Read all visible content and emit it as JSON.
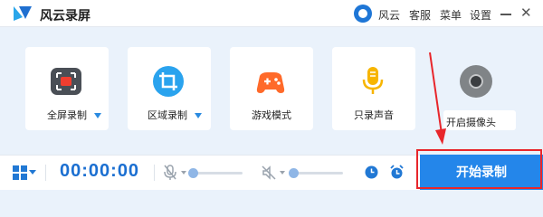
{
  "window": {
    "title": "风云录屏"
  },
  "titlebar": {
    "brand_label": "风云",
    "service_label": "客服",
    "menu_label": "菜单",
    "settings_label": "设置",
    "close_glyph": "✕"
  },
  "modes": [
    {
      "label": "全屏录制",
      "icon": "fullscreen-record-icon",
      "has_dropdown": true
    },
    {
      "label": "区域录制",
      "icon": "region-crop-icon",
      "has_dropdown": true
    },
    {
      "label": "游戏模式",
      "icon": "gamepad-icon",
      "has_dropdown": false
    },
    {
      "label": "只录声音",
      "icon": "microphone-icon",
      "has_dropdown": false
    }
  ],
  "camera": {
    "label": "开启摄像头",
    "icon": "camera-icon"
  },
  "bottom_bar": {
    "timer": "00:00:00",
    "start_label": "开始录制",
    "mic_level": 0.0,
    "sound_level": 0.0
  },
  "colors": {
    "accent": "#2486ea",
    "highlight": "#e8262b",
    "record_red": "#f03e2f",
    "game_orange": "#ff6a2a",
    "mic_yellow": "#f7b500"
  }
}
